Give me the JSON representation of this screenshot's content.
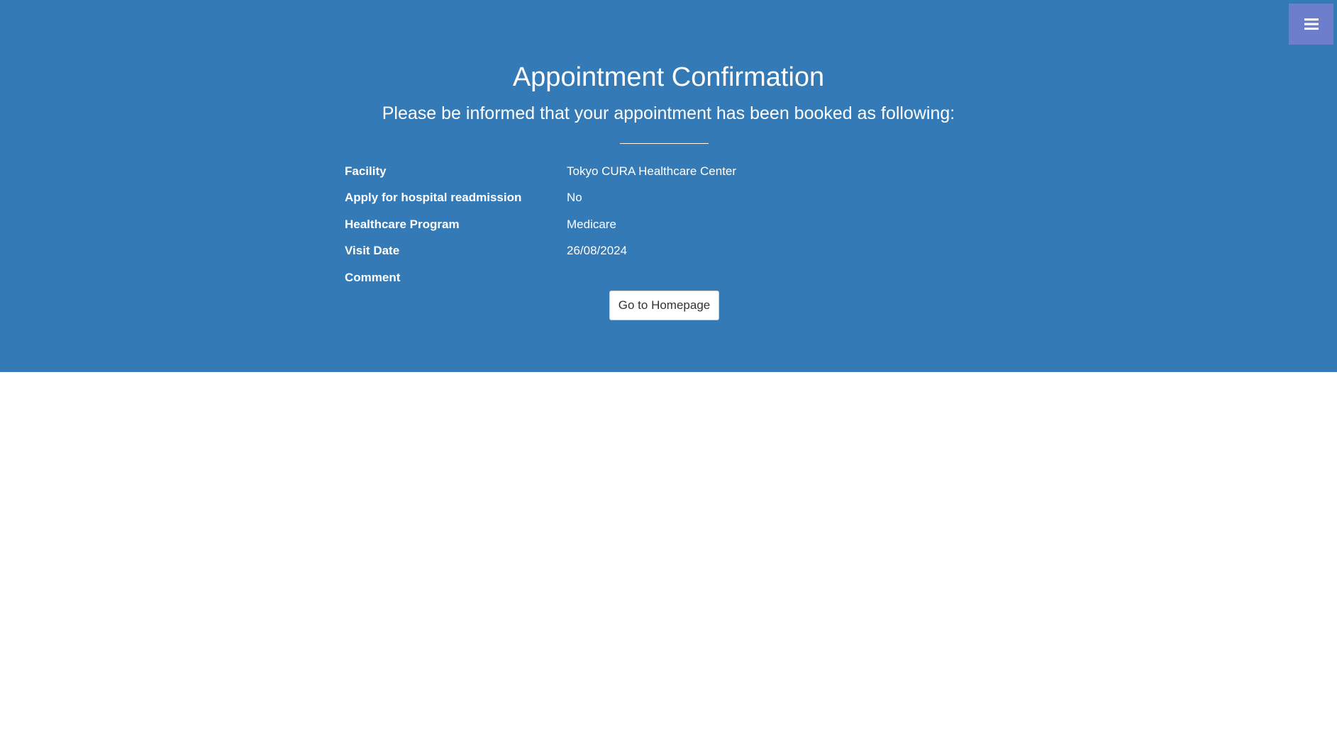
{
  "header": {
    "title": "Appointment Confirmation",
    "subtitle": "Please be informed that your appointment has been booked as following:"
  },
  "menu": {
    "icon": "hamburger-menu-icon"
  },
  "appointment": {
    "facility": {
      "label": "Facility",
      "value": "Tokyo CURA Healthcare Center"
    },
    "readmission": {
      "label": "Apply for hospital readmission",
      "value": "No"
    },
    "program": {
      "label": "Healthcare Program",
      "value": "Medicare"
    },
    "visit_date": {
      "label": "Visit Date",
      "value": "26/08/2024"
    },
    "comment": {
      "label": "Comment",
      "value": ""
    }
  },
  "actions": {
    "home_label": "Go to Homepage"
  },
  "colors": {
    "hero_background": "#337ab7",
    "menu_button": "#6d7fcc",
    "text_on_hero": "#ffffff",
    "button_text": "#333333"
  }
}
